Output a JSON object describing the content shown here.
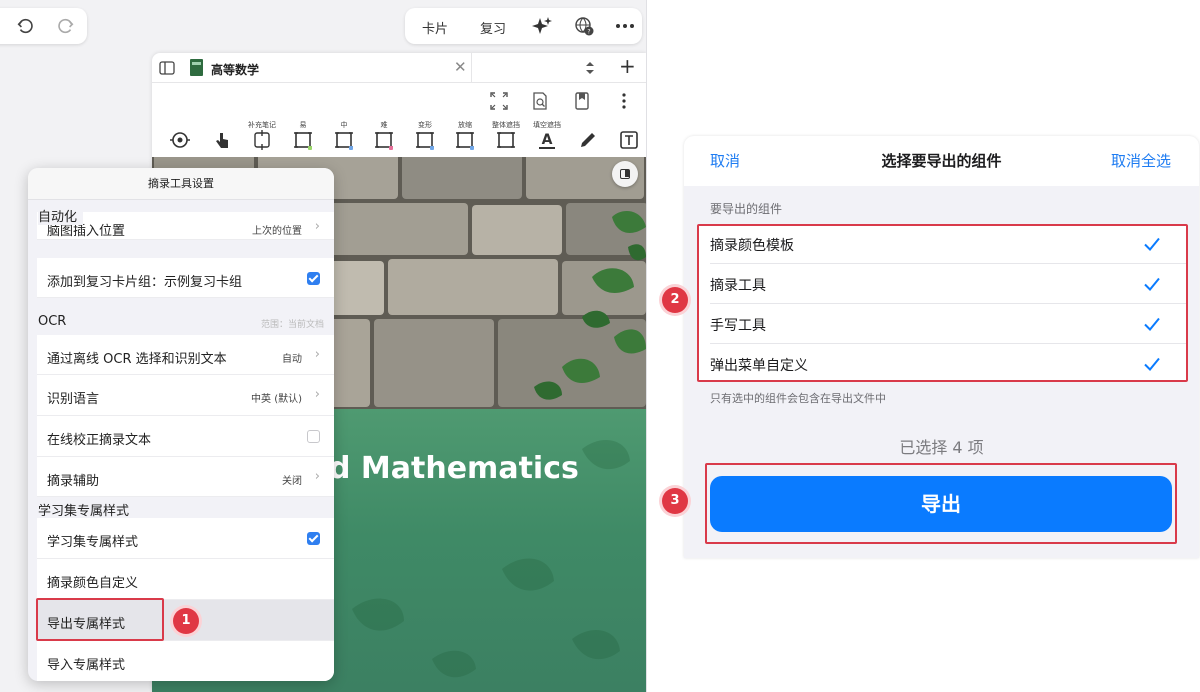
{
  "top_toolbar": {
    "card_label": "卡片",
    "review_label": "复习"
  },
  "doc": {
    "tab_title": "高等数学",
    "cover_caption": "d Mathematics"
  },
  "tools": [
    {
      "label": "",
      "icon": "gesture-icon"
    },
    {
      "label": "",
      "icon": "hand-pointer-icon"
    },
    {
      "label": "补充笔记",
      "icon": "add-note-frame-icon"
    },
    {
      "label": "易",
      "icon": "easy-frame-icon",
      "color": "#9bd86a"
    },
    {
      "label": "中",
      "icon": "medium-frame-icon",
      "color": "#6fa6e8"
    },
    {
      "label": "难",
      "icon": "hard-frame-icon",
      "color": "#e86f9a"
    },
    {
      "label": "变形",
      "icon": "variant-frame-icon",
      "color": "#6fa6e8"
    },
    {
      "label": "放缩",
      "icon": "scale-frame-icon",
      "color": "#6fa6e8"
    },
    {
      "label": "整体遮挡",
      "icon": "occlude-all-icon"
    },
    {
      "label": "填空遮挡",
      "icon": "fill-blank-icon"
    },
    {
      "label": "",
      "icon": "pencil-icon"
    },
    {
      "label": "",
      "icon": "text-box-icon"
    }
  ],
  "settings": {
    "title": "摘录工具设置",
    "automation_section": "自动化",
    "insert_position_label": "脑图插入位置",
    "insert_position_value": "上次的位置",
    "add_review_label": "添加到复习卡片组：示例复习卡组",
    "ocr_section": "OCR",
    "ocr_scope": "范围：当前文档",
    "offline_ocr_label": "通过离线 OCR 选择和识别文本",
    "offline_ocr_value": "自动",
    "lang_label": "识别语言",
    "lang_value": "中英 (默认)",
    "online_correct_label": "在线校正摘录文本",
    "assist_label": "摘录辅助",
    "assist_value": "关闭",
    "style_section": "学习集专属样式",
    "style_label": "学习集专属样式",
    "custom_color_label": "摘录颜色自定义",
    "export_style_label": "导出专属样式",
    "import_style_label": "导入专属样式"
  },
  "badges": {
    "b1": "1",
    "b2": "2",
    "b3": "3"
  },
  "export_dialog": {
    "cancel": "取消",
    "title": "选择要导出的组件",
    "deselect_all": "取消全选",
    "section_label": "要导出的组件",
    "items": [
      {
        "label": "摘录颜色模板"
      },
      {
        "label": "摘录工具"
      },
      {
        "label": "手写工具"
      },
      {
        "label": "弹出菜单自定义"
      }
    ],
    "note": "只有选中的组件会包含在导出文件中",
    "count": "已选择 4 项",
    "export_button": "导出"
  },
  "colors": {
    "accent": "#0a7bff",
    "highlight": "#d93a4a",
    "checkbox": "#2f7ff0"
  }
}
